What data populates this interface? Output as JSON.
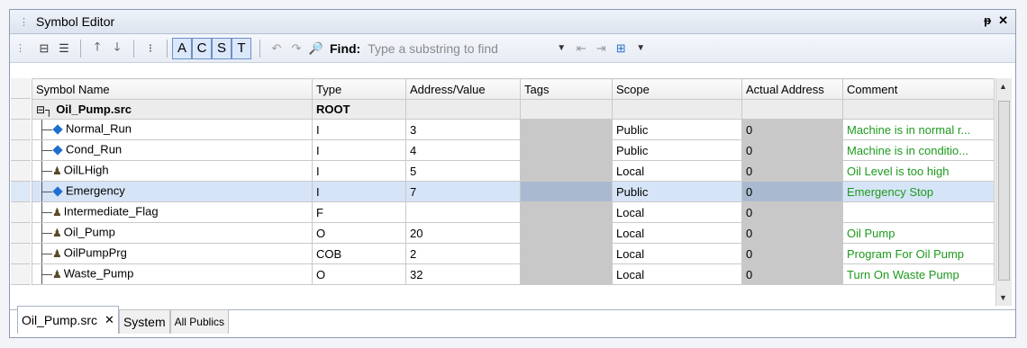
{
  "window": {
    "title": "Symbol Editor",
    "pin_icon": "pin-icon",
    "close_icon": "close-icon"
  },
  "toolbar": {
    "letters": [
      "A",
      "C",
      "S",
      "T"
    ],
    "find_label": "Find:",
    "find_placeholder": "Type a substring to find"
  },
  "columns": [
    "Symbol Name",
    "Type",
    "Address/Value",
    "Tags",
    "Scope",
    "Actual Address",
    "Comment"
  ],
  "root": {
    "name": "Oil_Pump.src",
    "type": "ROOT"
  },
  "rows": [
    {
      "name": "Normal_Run",
      "icon": "diamond",
      "type": "I",
      "address": "3",
      "tags": "",
      "scope": "Public",
      "actual": "0",
      "comment": "Machine is in normal r..."
    },
    {
      "name": "Cond_Run",
      "icon": "diamond",
      "type": "I",
      "address": "4",
      "tags": "",
      "scope": "Public",
      "actual": "0",
      "comment": "Machine is in conditio..."
    },
    {
      "name": "OilLHigh",
      "icon": "people",
      "type": "I",
      "address": "5",
      "tags": "",
      "scope": "Local",
      "actual": "0",
      "comment": "Oil Level is too high"
    },
    {
      "name": "Emergency",
      "icon": "diamond",
      "type": "I",
      "address": "7",
      "tags": "",
      "scope": "Public",
      "actual": "0",
      "comment": "Emergency Stop"
    },
    {
      "name": "Intermediate_Flag",
      "icon": "people",
      "type": "F",
      "address": "",
      "tags": "",
      "scope": "Local",
      "actual": "0",
      "comment": ""
    },
    {
      "name": "Oil_Pump",
      "icon": "people",
      "type": "O",
      "address": "20",
      "tags": "",
      "scope": "Local",
      "actual": "0",
      "comment": "Oil Pump"
    },
    {
      "name": "OilPumpPrg",
      "icon": "people",
      "type": "COB",
      "address": "2",
      "tags": "",
      "scope": "Local",
      "actual": "0",
      "comment": "Program For Oil Pump"
    },
    {
      "name": "Waste_Pump",
      "icon": "people",
      "type": "O",
      "address": "32",
      "tags": "",
      "scope": "Local",
      "actual": "0",
      "comment": "Turn On Waste Pump"
    }
  ],
  "tabs": [
    {
      "label": "Oil_Pump.src",
      "active": true
    },
    {
      "label": "System",
      "active": false
    },
    {
      "label": "All Publics",
      "active": false
    }
  ],
  "colors": {
    "comment": "#1d9a1d",
    "selection": "#d6e4f7",
    "accent": "#6d8fc7"
  }
}
